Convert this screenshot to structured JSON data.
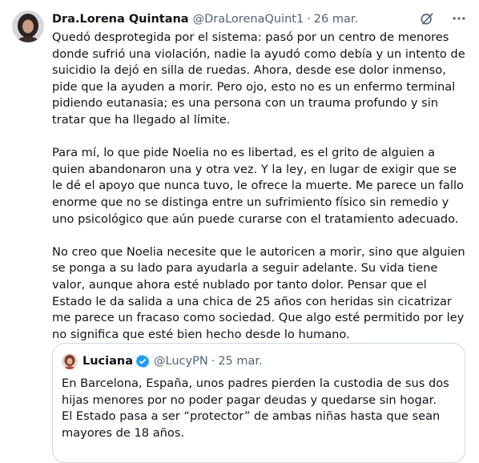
{
  "tweet": {
    "author_name": "Dra.Lorena Quintana",
    "author_handle": "@DraLorenaQuint1",
    "separator": "·",
    "date": "26 mar.",
    "icons": [
      "grok-icon",
      "more-icon"
    ],
    "paragraphs": [
      "Quedó desprotegida por el sistema: pasó por un centro de menores donde sufrió una violación, nadie la ayudó como debía y un intento de suicidio la dejó en silla de ruedas. Ahora, desde ese dolor inmenso, pide que la ayuden a morir. Pero ojo, esto no es un enfermo terminal pidiendo eutanasia; es una persona con un trauma profundo y sin tratar que ha llegado al límite.",
      "Para mí, lo que pide Noelia no es libertad, es el grito de alguien a quien abandonaron una y otra vez. Y la ley, en lugar de exigir que se le dé el apoyo que nunca tuvo, le ofrece la muerte. Me parece un fallo enorme que no se distinga entre un sufrimiento físico sin remedio y uno psicológico que aún puede curarse con el tratamiento adecuado.",
      "No creo que Noelia necesite que le autoricen a morir, sino que alguien se ponga a su lado para ayudarla a seguir adelante. Su vida tiene valor, aunque ahora esté nublado por tanto dolor. Pensar que el Estado le da salida a una chica de 25 años con heridas sin cicatrizar me parece un fracaso como sociedad. Que algo esté permitido por ley no significa que esté bien hecho desde lo humano."
    ]
  },
  "quoted": {
    "author_name": "Luciana",
    "verified_icon": "verified-badge-icon",
    "author_handle": "@LucyPN",
    "separator": "·",
    "date": "25 mar.",
    "text": "En Barcelona, España, unos padres pierden la custodia de sus dos hijas menores por no poder pagar deudas y quedarse sin hogar. El Estado pasa a ser “protector” de ambas niñas hasta que sean mayores de 18 años."
  },
  "colors": {
    "text": "#0f1419",
    "secondary": "#536471",
    "border": "#cfd9de",
    "verified": "#1d9bf0"
  }
}
